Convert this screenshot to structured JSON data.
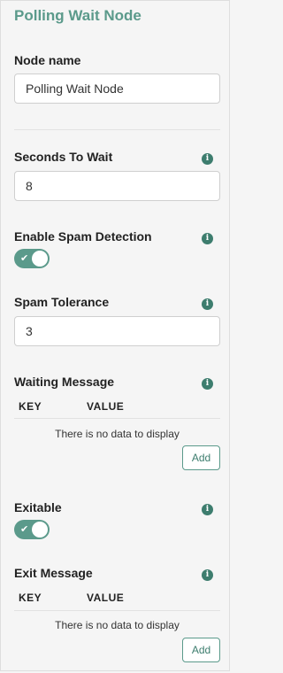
{
  "panel": {
    "title": "Polling Wait Node"
  },
  "node_name": {
    "label": "Node name",
    "value": "Polling Wait Node"
  },
  "seconds_to_wait": {
    "label": "Seconds To Wait",
    "value": "8",
    "info_icon": "info-icon"
  },
  "spam_detection": {
    "label": "Enable Spam Detection",
    "enabled": true,
    "check_glyph": "✔",
    "info_icon": "info-icon"
  },
  "spam_tolerance": {
    "label": "Spam Tolerance",
    "value": "3",
    "info_icon": "info-icon"
  },
  "waiting_message": {
    "label": "Waiting Message",
    "columns": [
      "KEY",
      "VALUE"
    ],
    "empty_text": "There is no data to display",
    "add_label": "Add",
    "info_icon": "info-icon"
  },
  "exitable": {
    "label": "Exitable",
    "enabled": true,
    "check_glyph": "✔",
    "info_icon": "info-icon"
  },
  "exit_message": {
    "label": "Exit Message",
    "columns": [
      "KEY",
      "VALUE"
    ],
    "empty_text": "There is no data to display",
    "add_label": "Add",
    "info_icon": "info-icon"
  },
  "colors": {
    "accent": "#5b9a8b",
    "info_icon": "#3d7d6e"
  }
}
